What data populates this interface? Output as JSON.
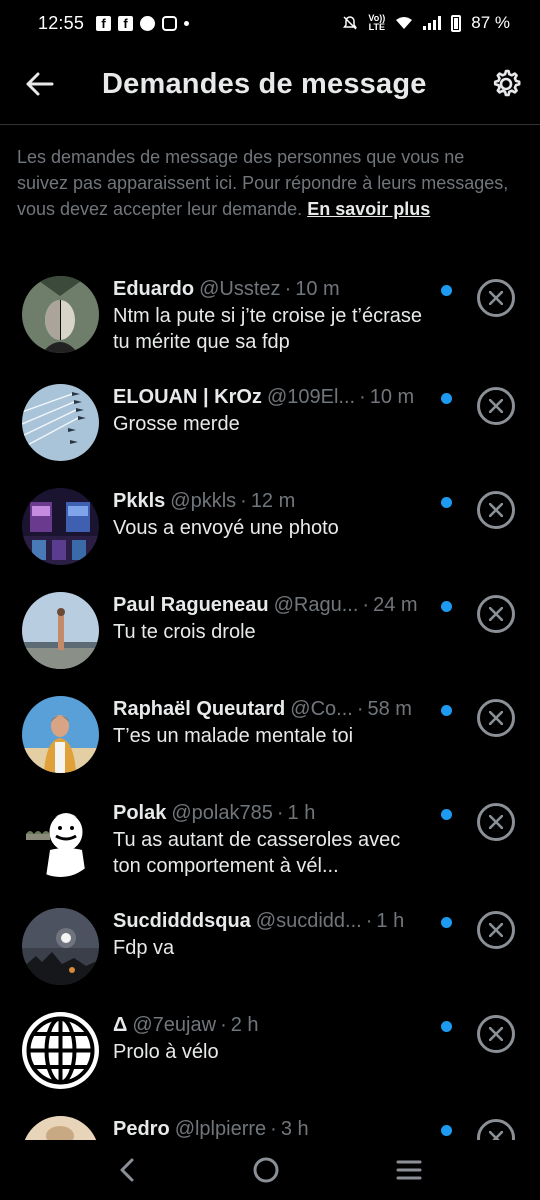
{
  "status_bar": {
    "time": "12:55",
    "lte_label": "Vo))\nLTE",
    "battery": "87 %"
  },
  "header": {
    "title": "Demandes de message"
  },
  "info": {
    "text": "Les demandes de message des personnes que vous ne suivez pas apparaissent ici. Pour répondre à leurs messages, vous devez accepter leur demande.",
    "link": "En savoir plus"
  },
  "requests": [
    {
      "name": "Eduardo",
      "handle": "@Usstez",
      "time": "10 m",
      "message": "Ntm la pute si j’te croise je t’écrase tu mérite que sa fdp"
    },
    {
      "name": "ELOUAN | KrOz",
      "handle": "@109El...",
      "time": "10 m",
      "message": "Grosse merde"
    },
    {
      "name": "Pkkls",
      "handle": "@pkkls",
      "time": "12 m",
      "message": "Vous a envoyé une photo"
    },
    {
      "name": "Paul Ragueneau",
      "handle": "@Ragu...",
      "time": "24 m",
      "message": "Tu te crois drole"
    },
    {
      "name": "Raphaël Queutard",
      "handle": "@Co...",
      "time": "58 m",
      "message": "T’es un malade mentale toi"
    },
    {
      "name": "Polak",
      "handle": "@polak785",
      "time": "1 h",
      "message": "Tu as autant de casseroles avec ton comportement à vél..."
    },
    {
      "name": "Sucdidddsqua",
      "handle": "@sucdidd...",
      "time": "1 h",
      "message": "Fdp va"
    },
    {
      "name": "Δ",
      "handle": "@7eujaw",
      "time": "2 h",
      "message": "Prolo à vélo"
    },
    {
      "name": "Pedro",
      "handle": "@lplpierre",
      "time": "3 h",
      "message": ""
    }
  ],
  "time_separator": "·",
  "colors": {
    "background": "#000000",
    "primary_text": "#e7e9ea",
    "secondary_text": "#71767b",
    "unread_dot": "#1d9bf0"
  }
}
